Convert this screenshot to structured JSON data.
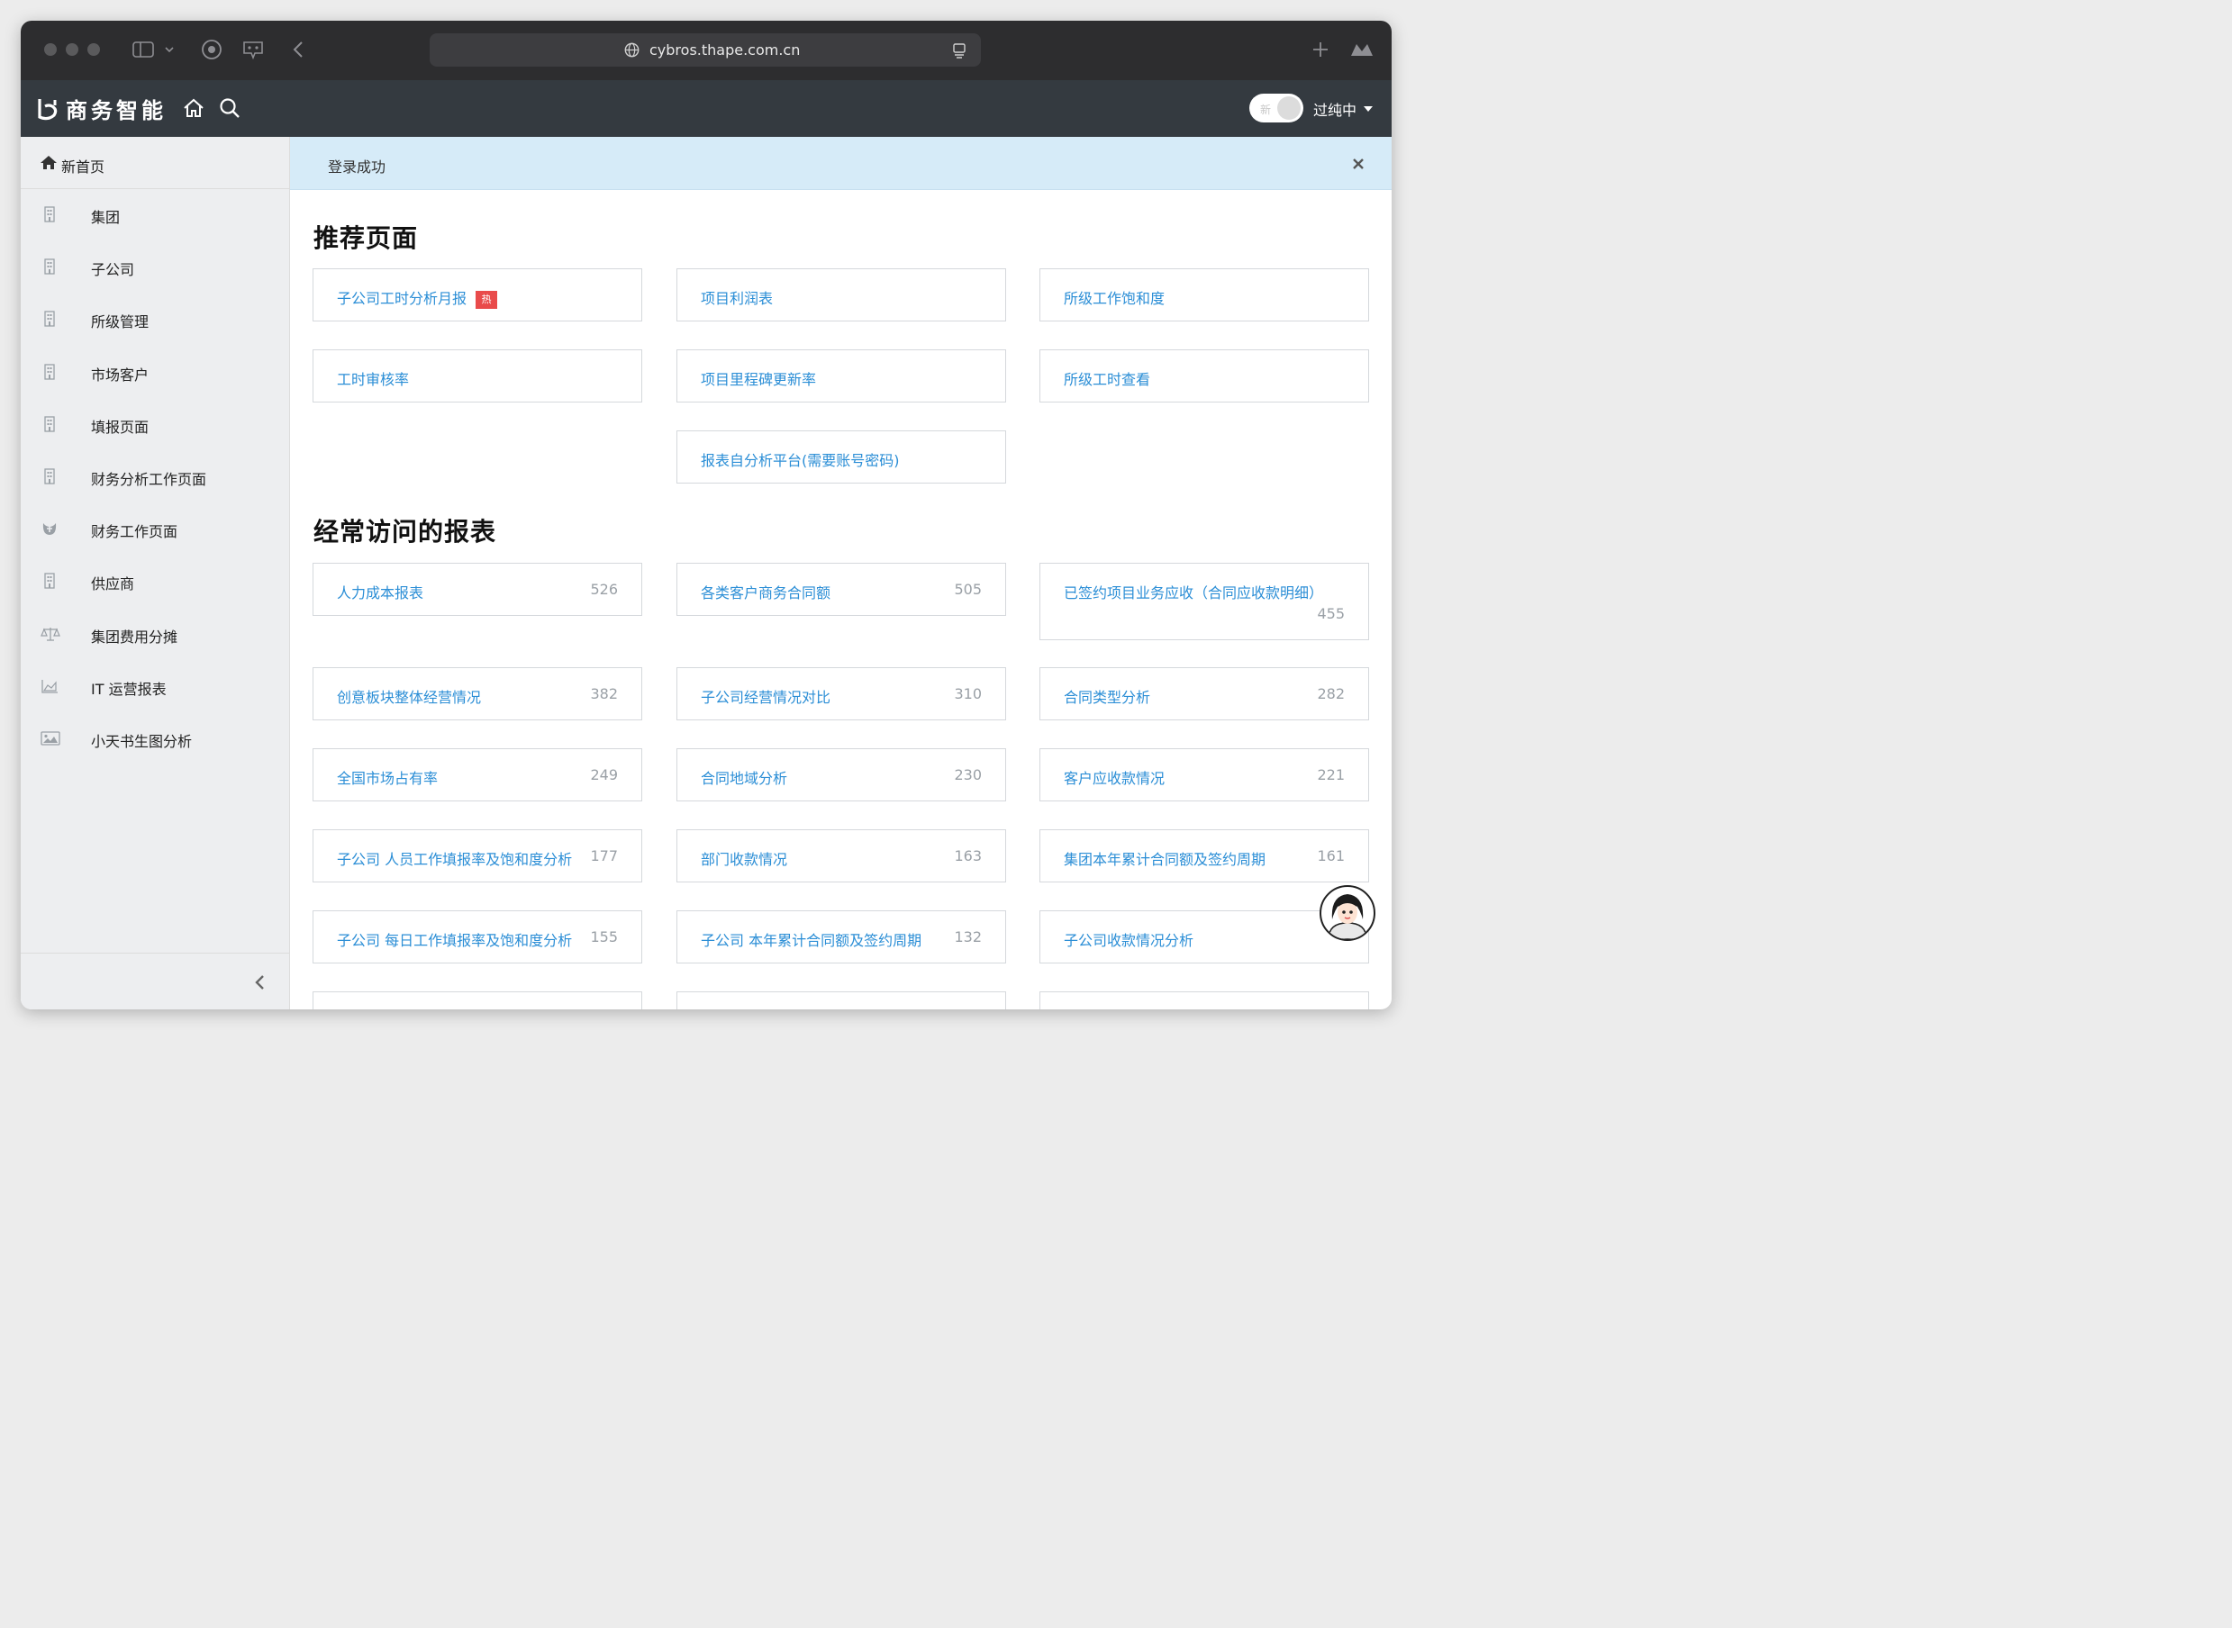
{
  "browser": {
    "url": "cybros.thape.com.cn"
  },
  "app": {
    "brand": "商务智能",
    "toggle_label": "新",
    "user_name": "过纯中"
  },
  "sidebar": {
    "home": "新首页",
    "items": [
      {
        "label": "集团",
        "icon": "building-icon"
      },
      {
        "label": "子公司",
        "icon": "building-icon"
      },
      {
        "label": "所级管理",
        "icon": "building-icon"
      },
      {
        "label": "市场客户",
        "icon": "building-icon"
      },
      {
        "label": "填报页面",
        "icon": "building-icon"
      },
      {
        "label": "财务分析工作页面",
        "icon": "building-icon"
      },
      {
        "label": "财务工作页面",
        "icon": "finance-icon"
      },
      {
        "label": "供应商",
        "icon": "building-icon"
      },
      {
        "label": "集团费用分摊",
        "icon": "scale-icon"
      },
      {
        "label": "IT 运营报表",
        "icon": "area-chart-icon"
      },
      {
        "label": "小天书生图分析",
        "icon": "image-icon"
      }
    ]
  },
  "alert": {
    "message": "登录成功"
  },
  "recommended": {
    "title": "推荐页面",
    "hot_badge": "热",
    "cards": [
      {
        "label": "子公司工时分析月报",
        "hot": true
      },
      {
        "label": "项目利润表"
      },
      {
        "label": "所级工作饱和度"
      },
      {
        "label": "工时审核率"
      },
      {
        "label": "项目里程碑更新率"
      },
      {
        "label": "所级工时查看"
      },
      {
        "label": "报表自分析平台(需要账号密码)"
      }
    ]
  },
  "frequent": {
    "title": "经常访问的报表",
    "cards": [
      {
        "label": "人力成本报表",
        "count": "526"
      },
      {
        "label": "各类客户商务合同额",
        "count": "505"
      },
      {
        "label": "已签约项目业务应收（合同应收款明细）",
        "count": "455"
      },
      {
        "label": "创意板块整体经营情况",
        "count": "382"
      },
      {
        "label": "子公司经营情况对比",
        "count": "310"
      },
      {
        "label": "合同类型分析",
        "count": "282"
      },
      {
        "label": "全国市场占有率",
        "count": "249"
      },
      {
        "label": "合同地域分析",
        "count": "230"
      },
      {
        "label": "客户应收款情况",
        "count": "221"
      },
      {
        "label": "子公司 人员工作填报率及饱和度分析",
        "count": "177"
      },
      {
        "label": "部门收款情况",
        "count": "163"
      },
      {
        "label": "集团本年累计合同额及签约周期",
        "count": "161"
      },
      {
        "label": "子公司 每日工作填报率及饱和度分析",
        "count": "155"
      },
      {
        "label": "子公司 本年累计合同额及签约周期",
        "count": "132"
      },
      {
        "label": "子公司收款情况分析",
        "count": ""
      }
    ]
  },
  "colors": {
    "link": "#2b8ed6",
    "appbar": "#343a40",
    "alert": "#d6ebf8",
    "hot": "#e94b4b"
  }
}
